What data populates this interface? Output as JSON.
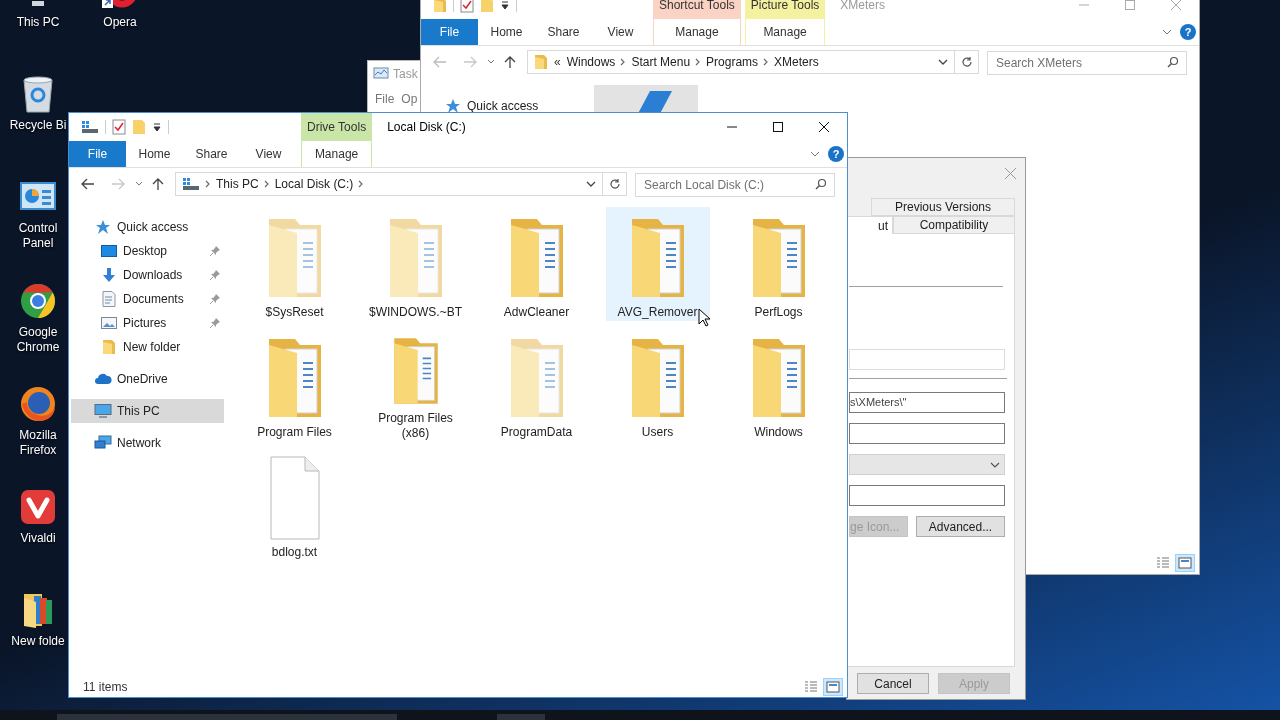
{
  "desktop_icons": [
    {
      "label": "This PC",
      "kind": "pc"
    },
    {
      "label": "Opera",
      "kind": "opera"
    },
    {
      "label": "Recycle Bi",
      "kind": "recycle"
    },
    {
      "label": "Control Panel",
      "kind": "control"
    },
    {
      "label": "Google Chrome",
      "kind": "chrome"
    },
    {
      "label": "Mozilla Firefox",
      "kind": "firefox"
    },
    {
      "label": "Vivaldi",
      "kind": "vivaldi"
    },
    {
      "label": "New folde",
      "kind": "folder"
    }
  ],
  "task_manager": {
    "title": "Task",
    "menu": [
      "File",
      "Op"
    ]
  },
  "xmeters_window": {
    "title": "XMeters",
    "active": false,
    "help": "?",
    "ribbon_tabs": [
      {
        "label": "File",
        "kind": "file"
      },
      {
        "label": "Home",
        "kind": "tab"
      },
      {
        "label": "Share",
        "kind": "tab"
      },
      {
        "label": "View",
        "kind": "tab"
      },
      {
        "label": "Manage",
        "kind": "context",
        "group": "Shortcut Tools",
        "color": "#fbd3c4"
      },
      {
        "label": "Manage",
        "kind": "context",
        "group": "Picture Tools",
        "color": "#f4f1a0"
      }
    ],
    "address": {
      "overflow": "«",
      "crumbs": [
        "Windows",
        "Start Menu",
        "Programs",
        "XMeters"
      ],
      "trailing_chevron": false
    },
    "search": {
      "placeholder": "Search XMeters"
    },
    "nav": [
      {
        "label": "Quick access",
        "kind": "quick",
        "selected": false
      }
    ],
    "views": [
      {
        "kind": "details",
        "selected": false
      },
      {
        "kind": "large_icons",
        "selected": true
      }
    ]
  },
  "properties_dialog": {
    "tab_rows": [
      [
        {
          "label": "Previous Versions",
          "selected": false
        }
      ],
      [
        {
          "label": "ut",
          "selected": true
        },
        {
          "label": "Compatibility",
          "selected": false
        }
      ]
    ],
    "fields": [
      {
        "kind": "text",
        "disabled": true
      },
      {
        "kind": "text",
        "disabled": false,
        "value": "s\\XMeters\\\""
      },
      {
        "kind": "text",
        "disabled": false
      },
      {
        "kind": "dropdown",
        "disabled": true
      },
      {
        "kind": "text",
        "disabled": false
      }
    ],
    "buttons": [
      {
        "label": "ge Icon...",
        "disabled": true
      },
      {
        "label": "Advanced...",
        "disabled": false
      }
    ],
    "footer_buttons": [
      {
        "label": "Cancel",
        "disabled": false
      },
      {
        "label": "Apply",
        "disabled": true
      }
    ]
  },
  "main_window": {
    "title": "Local Disk (C:)",
    "active": true,
    "help": "?",
    "ribbon_tabs": [
      {
        "label": "File",
        "kind": "file"
      },
      {
        "label": "Home",
        "kind": "tab"
      },
      {
        "label": "Share",
        "kind": "tab"
      },
      {
        "label": "View",
        "kind": "tab"
      },
      {
        "label": "Manage",
        "kind": "context",
        "group": "Drive Tools",
        "color": "#c9e6a8"
      }
    ],
    "address": {
      "crumbs": [
        "This PC",
        "Local Disk (C:)"
      ],
      "trailing_chevron": true
    },
    "search": {
      "placeholder": "Search Local Disk (C:)"
    },
    "nav": [
      {
        "label": "Quick access",
        "kind": "quick",
        "selected": false,
        "children": [
          {
            "label": "Desktop",
            "kind": "desktop",
            "pinned": true,
            "selected": false
          },
          {
            "label": "Downloads",
            "kind": "downloads",
            "pinned": true,
            "selected": false
          },
          {
            "label": "Documents",
            "kind": "documents",
            "pinned": true,
            "selected": false
          },
          {
            "label": "Pictures",
            "kind": "pictures",
            "pinned": true,
            "selected": false
          },
          {
            "label": "New folder",
            "kind": "folder",
            "pinned": false,
            "selected": false
          }
        ]
      },
      {
        "label": "OneDrive",
        "kind": "onedrive",
        "selected": false
      },
      {
        "label": "This PC",
        "kind": "pc",
        "selected": true
      },
      {
        "label": "Network",
        "kind": "network",
        "selected": false
      }
    ],
    "items": [
      {
        "label": "$SysReset",
        "kind": "folder",
        "hidden": true,
        "hovered": false
      },
      {
        "label": "$WINDOWS.~BT",
        "kind": "folder",
        "hidden": true,
        "hovered": false
      },
      {
        "label": "AdwCleaner",
        "kind": "folder",
        "hidden": false,
        "hovered": false
      },
      {
        "label": "AVG_Remover",
        "kind": "folder",
        "hidden": false,
        "hovered": true
      },
      {
        "label": "PerfLogs",
        "kind": "folder",
        "hidden": false,
        "hovered": false
      },
      {
        "label": "Program Files",
        "kind": "folder",
        "hidden": false,
        "hovered": false
      },
      {
        "label": "Program Files (x86)",
        "kind": "folder",
        "hidden": false,
        "hovered": false
      },
      {
        "label": "ProgramData",
        "kind": "folder",
        "hidden": true,
        "hovered": false
      },
      {
        "label": "Users",
        "kind": "folder",
        "hidden": false,
        "hovered": false
      },
      {
        "label": "Windows",
        "kind": "folder",
        "hidden": false,
        "hovered": false
      },
      {
        "label": "bdlog.txt",
        "kind": "file",
        "hidden": false,
        "hovered": false
      }
    ],
    "status": "11 items",
    "views": [
      {
        "kind": "details",
        "selected": false
      },
      {
        "kind": "large_icons",
        "selected": true
      }
    ]
  }
}
